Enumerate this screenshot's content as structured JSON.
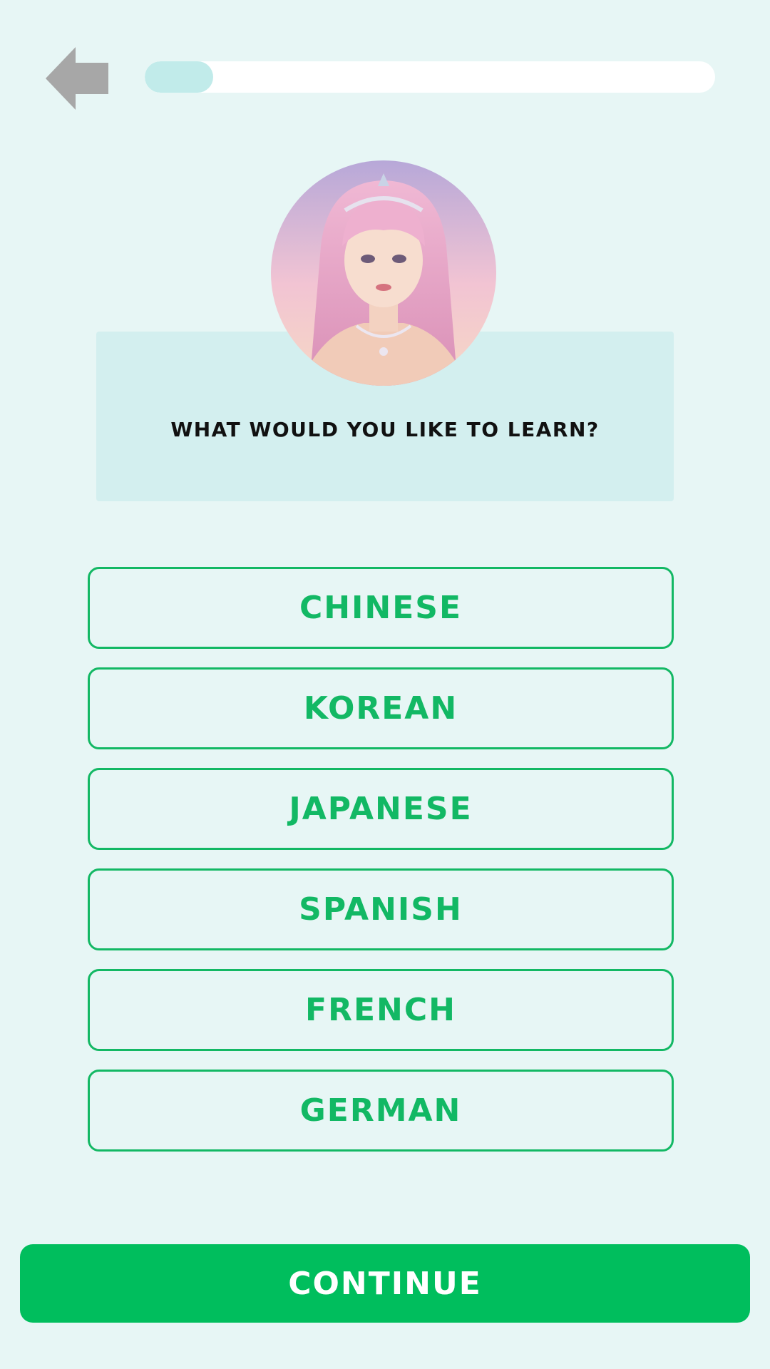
{
  "header": {
    "back_icon": "arrow-left-icon",
    "progress_fraction": 0.12
  },
  "avatar": {
    "icon": "avatar-image"
  },
  "question": {
    "text": "WHAT WOULD YOU LIKE TO LEARN?"
  },
  "options": [
    {
      "label": "CHINESE"
    },
    {
      "label": "KOREAN"
    },
    {
      "label": "JAPANESE"
    },
    {
      "label": "SPANISH"
    },
    {
      "label": "FRENCH"
    },
    {
      "label": "GERMAN"
    }
  ],
  "footer": {
    "continue_label": "CONTINUE"
  },
  "colors": {
    "background": "#e7f6f5",
    "accent": "#00be5d",
    "option_border": "#13b864",
    "progress_fill": "#c1ebea",
    "card": "#d3efef"
  }
}
